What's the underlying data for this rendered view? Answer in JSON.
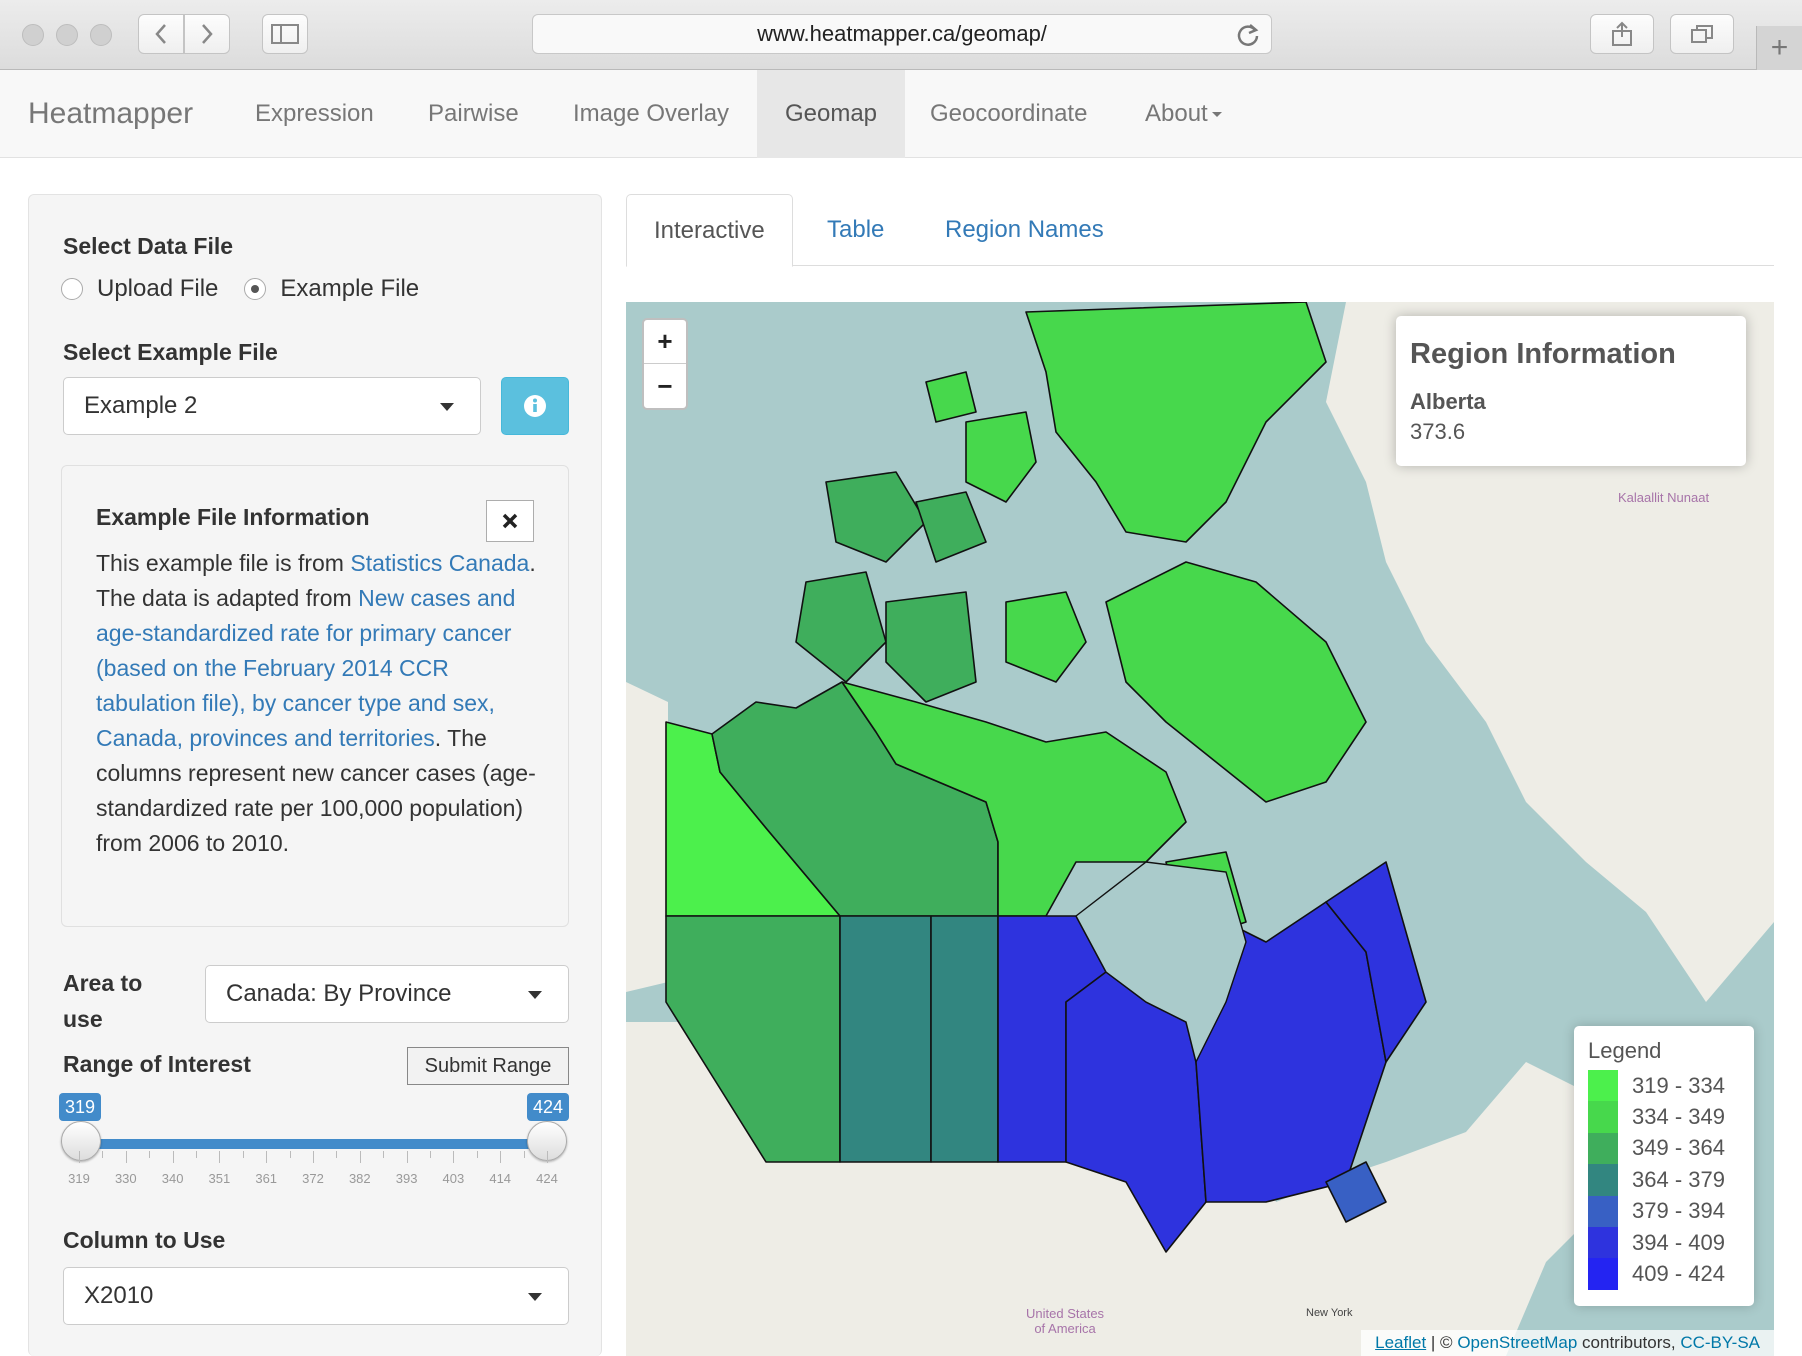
{
  "browser": {
    "url": "www.heatmapper.ca/geomap/"
  },
  "navbar": {
    "brand": "Heatmapper",
    "items": [
      {
        "label": "Expression"
      },
      {
        "label": "Pairwise"
      },
      {
        "label": "Image Overlay"
      },
      {
        "label": "Geomap",
        "active": true
      },
      {
        "label": "Geocoordinate"
      },
      {
        "label": "About"
      }
    ]
  },
  "sidebar": {
    "select_data_file_label": "Select Data File",
    "radio_upload": "Upload File",
    "radio_example": "Example File",
    "radio_selected": "Example File",
    "select_example_label": "Select Example File",
    "example_value": "Example 2",
    "info_title": "Example File Information",
    "info_text": {
      "t1": "This example file is from ",
      "l1": "Statistics Canada",
      "t2": ". The data is adapted from ",
      "l2": "New cases and age-standardized rate for primary cancer (based on the February 2014 CCR tabulation file), by cancer type and sex, Canada, provinces and territories",
      "t3": ". The columns represent new cancer cases (age-standardized rate per 100,000 population) from 2006 to 2010."
    },
    "area_label_1": "Area to",
    "area_label_2": "use",
    "area_value": "Canada: By Province",
    "range_label": "Range of Interest",
    "submit_range": "Submit Range",
    "range_min_badge": "319",
    "range_max_badge": "424",
    "tick_labels": [
      "319",
      "330",
      "340",
      "351",
      "361",
      "372",
      "382",
      "393",
      "403",
      "414",
      "424"
    ],
    "column_label": "Column to Use",
    "column_value": "X2010"
  },
  "tabs": [
    {
      "label": "Interactive",
      "active": true
    },
    {
      "label": "Table"
    },
    {
      "label": "Region Names"
    }
  ],
  "map": {
    "region_info_title": "Region Information",
    "region_name": "Alberta",
    "region_value": "373.6",
    "label_greenland": "Kalaallit Nunaat",
    "label_usa_1": "United States",
    "label_usa_2": "of America",
    "label_ny": "New York",
    "legend_title": "Legend",
    "legend": [
      {
        "range": "319 - 334",
        "color": "#4cf04c"
      },
      {
        "range": "334 - 349",
        "color": "#47d84c"
      },
      {
        "range": "349 - 364",
        "color": "#3fae5c"
      },
      {
        "range": "364 - 379",
        "color": "#328680"
      },
      {
        "range": "379 - 394",
        "color": "#3860c4"
      },
      {
        "range": "394 - 409",
        "color": "#2e33de"
      },
      {
        "range": "409 - 424",
        "color": "#2424f2"
      }
    ],
    "attribution": {
      "leaflet": "Leaflet",
      "sep": " | © ",
      "osm": "OpenStreetMap",
      "mid": " contributors, ",
      "license": "CC-BY-SA"
    }
  }
}
